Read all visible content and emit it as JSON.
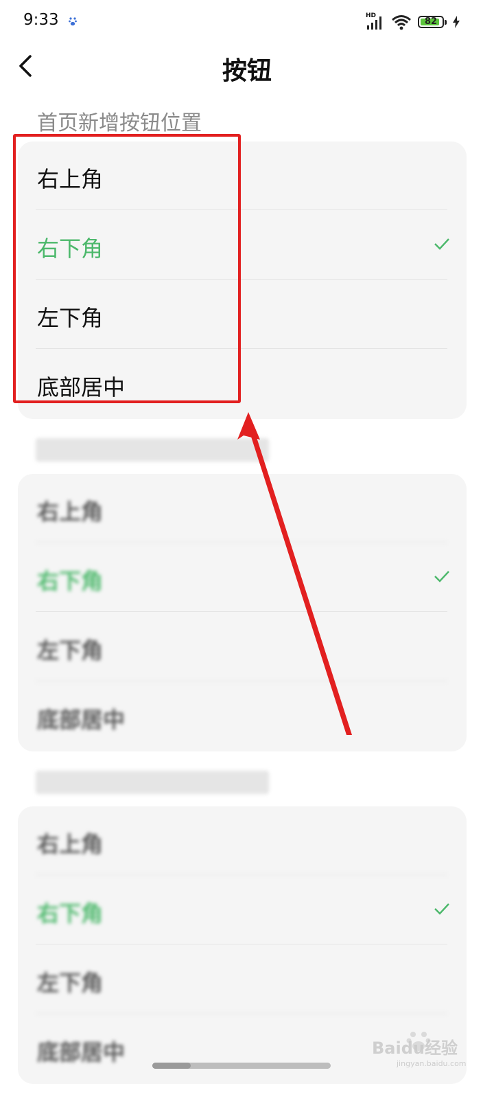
{
  "status": {
    "time": "9:33",
    "network_label": "HD",
    "battery": "82"
  },
  "nav": {
    "title": "按钮"
  },
  "sections": [
    {
      "header": "首页新增按钮位置",
      "options": [
        {
          "label": "右上角",
          "selected": false
        },
        {
          "label": "右下角",
          "selected": true
        },
        {
          "label": "左下角",
          "selected": false
        },
        {
          "label": "底部居中",
          "selected": false
        }
      ]
    },
    {
      "header": "",
      "options": [
        {
          "label": "右上角",
          "selected": false
        },
        {
          "label": "右下角",
          "selected": true
        },
        {
          "label": "左下角",
          "selected": false
        },
        {
          "label": "底部居中",
          "selected": false
        }
      ]
    },
    {
      "header": "",
      "options": [
        {
          "label": "右上角",
          "selected": false
        },
        {
          "label": "右下角",
          "selected": true
        },
        {
          "label": "左下角",
          "selected": false
        },
        {
          "label": "底部居中",
          "selected": false
        }
      ]
    }
  ],
  "watermark": {
    "text": "Baidu经验",
    "url": "jingyan.baidu.com"
  },
  "colors": {
    "accent": "#4cb86b",
    "highlight": "#e22020"
  }
}
